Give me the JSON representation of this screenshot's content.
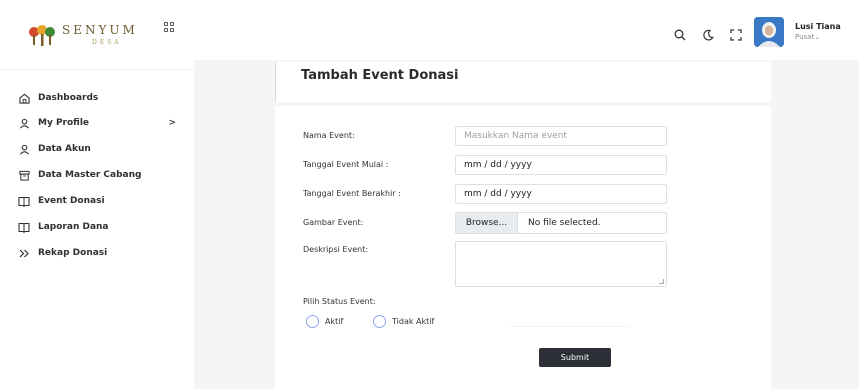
{
  "brand": {
    "name": "SENYUM",
    "sub": "DESA"
  },
  "sidebar": {
    "items": [
      {
        "label": "Dashboards",
        "icon": "home-icon"
      },
      {
        "label": "My Profile",
        "icon": "user-icon",
        "chevron": ">"
      },
      {
        "label": "Data Akun",
        "icon": "user-icon"
      },
      {
        "label": "Data Master Cabang",
        "icon": "archive-icon"
      },
      {
        "label": "Event Donasi",
        "icon": "book-icon"
      },
      {
        "label": "Laporan Dana",
        "icon": "book-icon"
      },
      {
        "label": "Rekap Donasi",
        "icon": "double-chevron-icon"
      }
    ]
  },
  "topbar": {
    "user_name": "Lusi Tiana",
    "user_role": "Pusat⌄"
  },
  "form": {
    "title": "Tambah Event Donasi",
    "fields": {
      "nama_label": "Nama Event:",
      "nama_placeholder": "Masukkan Nama event",
      "mulai_label": "Tanggal Event Mulai :",
      "mulai_value": "mm / dd / yyyy",
      "berakhir_label": "Tanggal Event Berakhir :",
      "berakhir_value": "mm / dd / yyyy",
      "gambar_label": "Gambar Event:",
      "browse_label": "Browse...",
      "file_status": "No file selected.",
      "deskripsi_label": "Deskripsi Event:",
      "status_label": "Pilih Status Event:",
      "status_options": [
        "Aktif",
        "Tidak Aktif"
      ]
    },
    "submit_label": "Submit"
  },
  "colors": {
    "accent": "#2c2f36",
    "radio_border": "#8ea6e8",
    "avatar_bg": "#3a79c6"
  }
}
